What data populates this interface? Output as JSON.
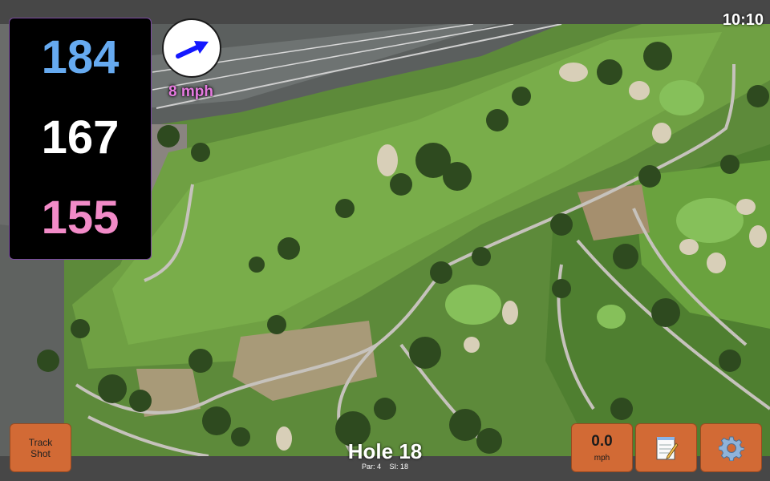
{
  "clock": "10:10",
  "yardages": {
    "back": "184",
    "center": "167",
    "front": "155",
    "back_color": "#66aaf0",
    "center_color": "#ffffff",
    "front_color": "#f28bc8"
  },
  "wind": {
    "speed_label": "8 mph",
    "arrow_icon": "wind-direction-arrow",
    "label_color": "#e67ae0",
    "arrow_color": "#1418ff"
  },
  "buttons": {
    "track_line1": "Track",
    "track_line2": "Shot",
    "wind_value": "0.0",
    "wind_unit": "mph",
    "notes_icon": "notepad-icon",
    "settings_icon": "gear-icon",
    "accent": "#d26a35"
  },
  "hole": {
    "title": "Hole 18",
    "par": "Par: 4",
    "si": "SI: 18"
  }
}
